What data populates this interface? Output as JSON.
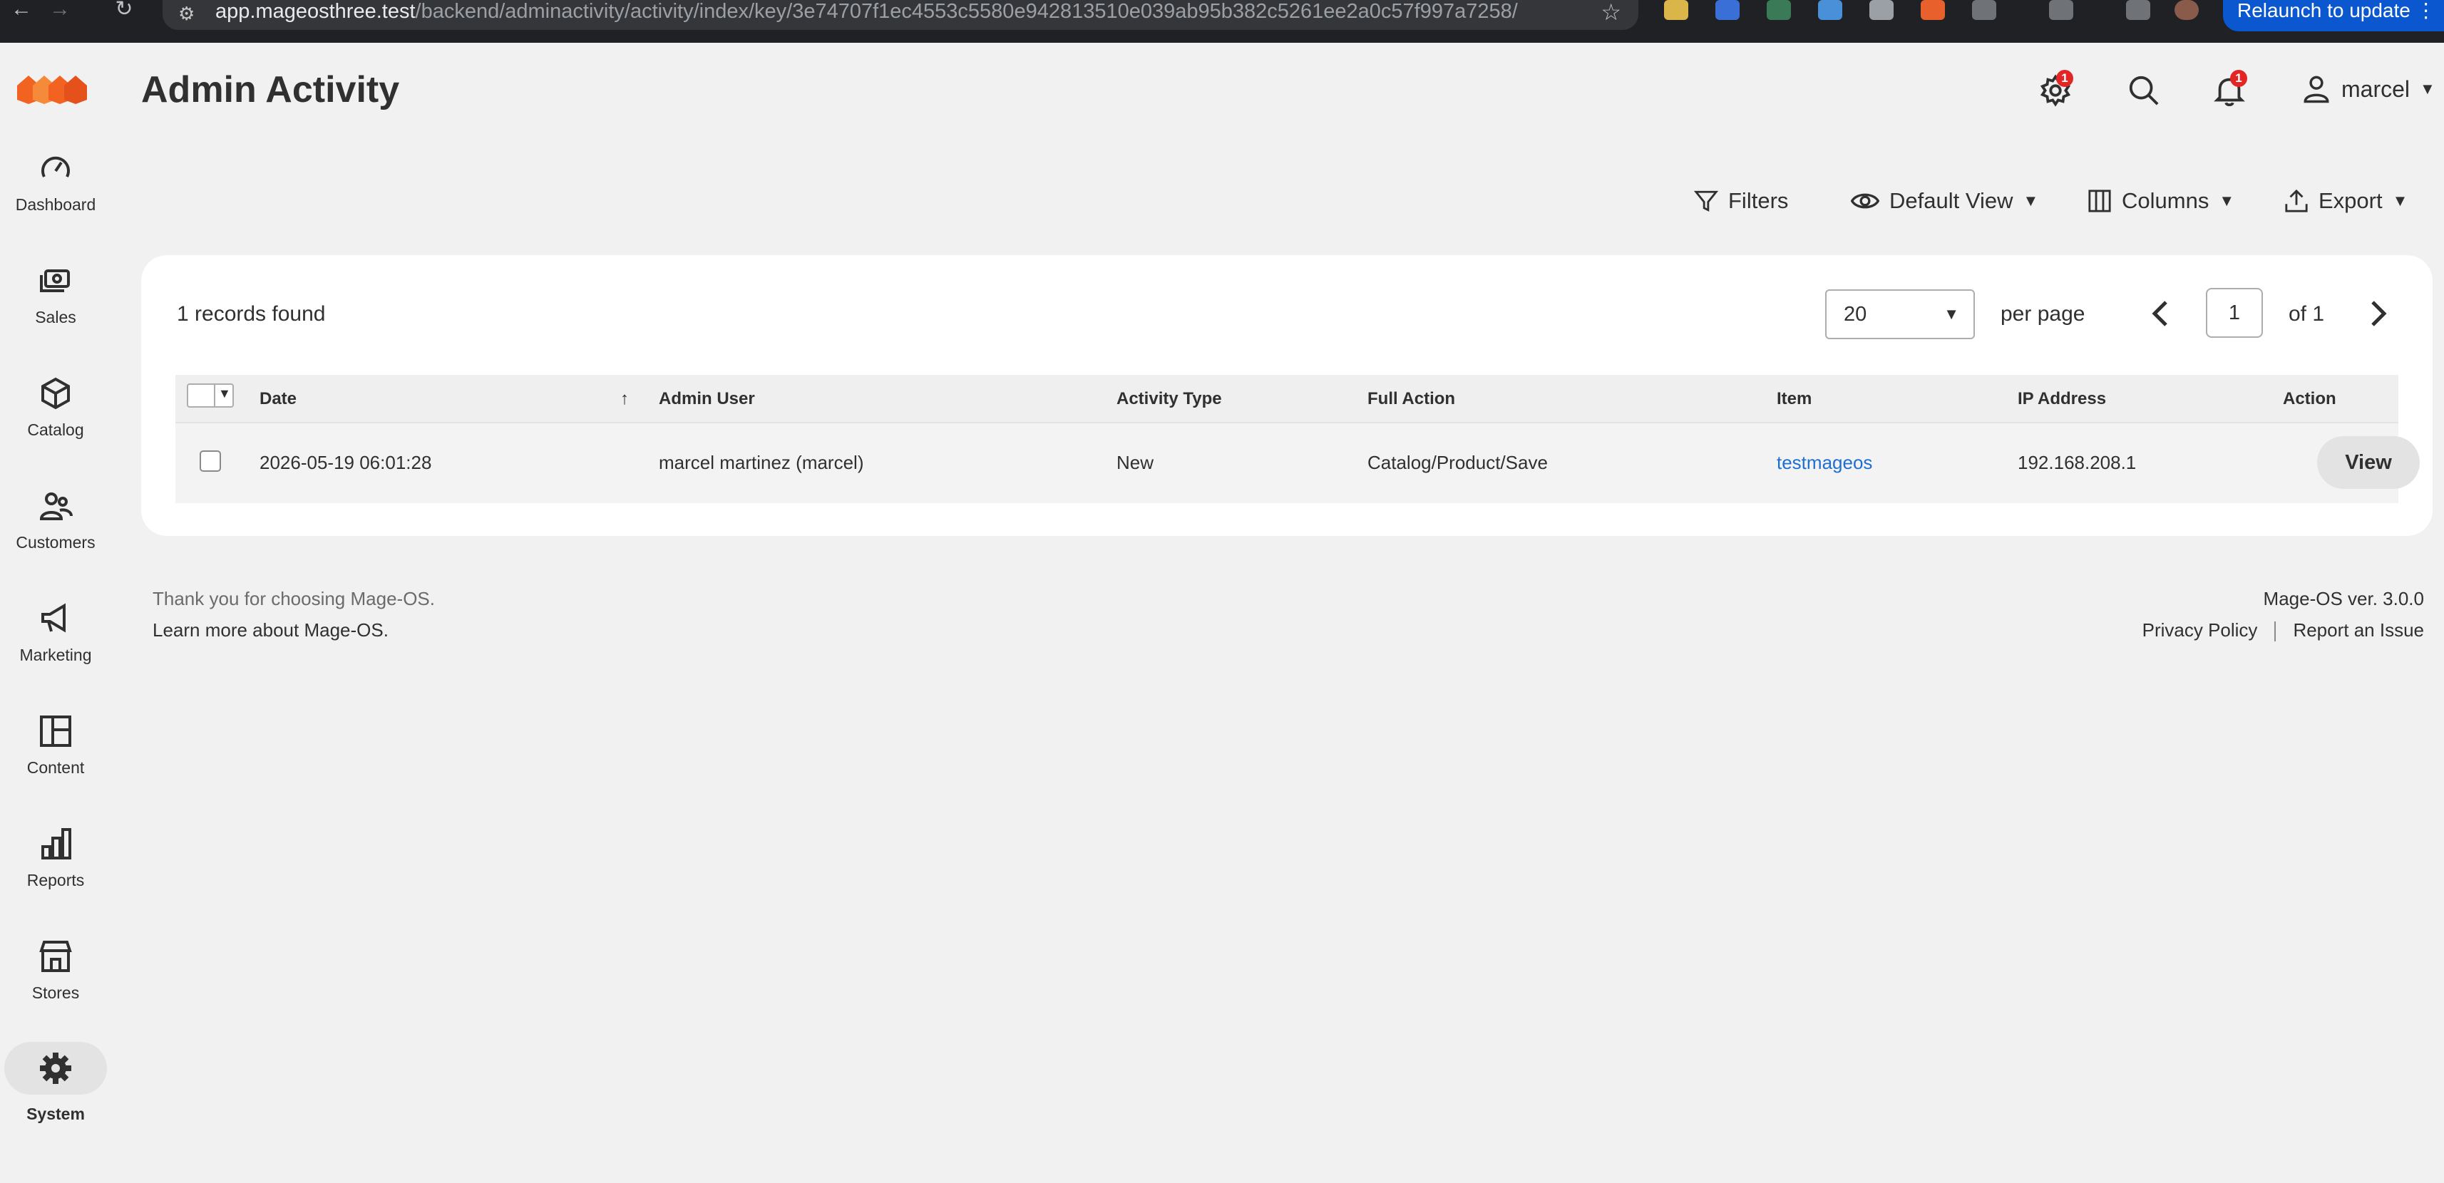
{
  "browser": {
    "url_host": "app.mageosthree.test",
    "url_path": "/backend/adminactivity/activity/index/key/3e74707f1ec4553c5580e942813510e039ab95b382c5261ee2a0c57f997a7258/",
    "relaunch_label": "Relaunch to update",
    "relaunch_icon": "more-vert-icon"
  },
  "sidebar": {
    "items": [
      {
        "label": "Dashboard",
        "icon": "dashboard-icon"
      },
      {
        "label": "Sales",
        "icon": "sales-icon"
      },
      {
        "label": "Catalog",
        "icon": "catalog-icon"
      },
      {
        "label": "Customers",
        "icon": "customers-icon"
      },
      {
        "label": "Marketing",
        "icon": "marketing-icon"
      },
      {
        "label": "Content",
        "icon": "content-icon"
      },
      {
        "label": "Reports",
        "icon": "reports-icon"
      },
      {
        "label": "Stores",
        "icon": "stores-icon"
      },
      {
        "label": "System",
        "icon": "system-icon",
        "active": true
      }
    ]
  },
  "header": {
    "title": "Admin Activity",
    "system_messages_count": "1",
    "notifications_count": "1",
    "user_name": "marcel"
  },
  "toolbar": {
    "filters_label": "Filters",
    "view_label": "Default View",
    "columns_label": "Columns",
    "export_label": "Export"
  },
  "grid": {
    "records_found": "1 records found",
    "per_page_value": "20",
    "per_page_label": "per page",
    "current_page": "1",
    "page_of": "of 1",
    "columns": [
      "Date",
      "Admin User",
      "Activity Type",
      "Full Action",
      "Item",
      "IP Address",
      "Action"
    ],
    "sort_indicator": "↑",
    "rows": [
      {
        "date": "2026-05-19 06:01:28",
        "admin_user": "marcel martinez (marcel)",
        "activity_type": "New",
        "full_action": "Catalog/Product/Save",
        "item": "testmageos",
        "ip_address": "192.168.208.1",
        "action": "View"
      }
    ]
  },
  "footer": {
    "thanks": "Thank you for choosing Mage-OS.",
    "learn_more": "Learn more about Mage-OS.",
    "version": "Mage-OS ver. 3.0.0",
    "privacy": "Privacy Policy",
    "report": "Report an Issue"
  },
  "colors": {
    "accent_orange": "#f26322",
    "badge_red": "#e22626",
    "link_blue": "#1f6fd0",
    "relaunch_blue": "#0b57d0"
  }
}
